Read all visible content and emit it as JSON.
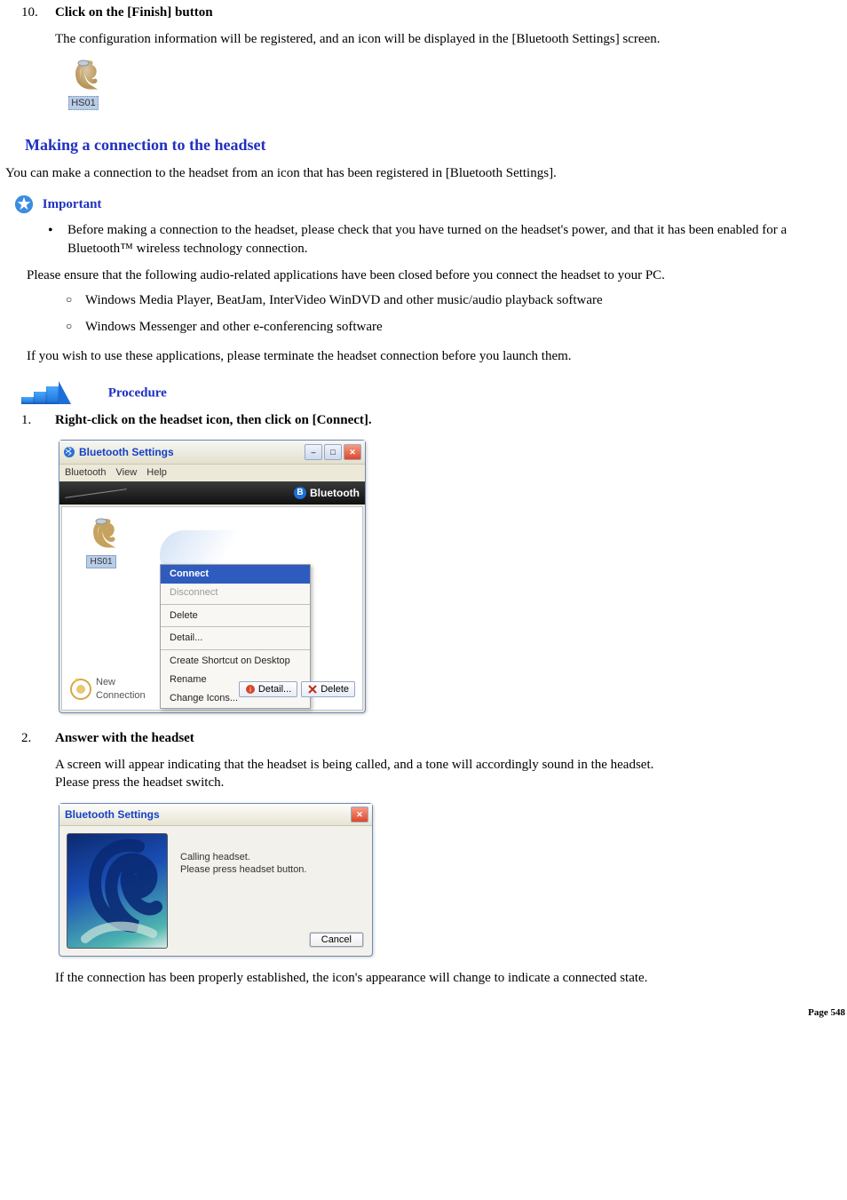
{
  "top_step": {
    "number": "10.",
    "title": "Click on the [Finish] button",
    "desc": "The configuration information will be registered, and an icon will be displayed in the [Bluetooth Settings] screen.",
    "icon_label": "HS01"
  },
  "section_title": "Making a connection to the headset",
  "section_intro": "You can make a connection to the headset from an icon that has been registered in [Bluetooth Settings].",
  "important_label": "Important",
  "important_bullet": "Before making a connection to the headset, please check that you have turned on the headset's power, and that it has been enabled for a Bluetooth™ wireless technology connection.",
  "ensure_text": "Please ensure that the following audio-related applications have been closed before you connect the headset to your PC.",
  "apps": [
    "Windows Media Player, BeatJam, InterVideo WinDVD and other music/audio playback software",
    "Windows Messenger and other e-conferencing software"
  ],
  "terminate_text": "If you wish to use these applications, please terminate the headset connection before you launch them.",
  "procedure_label": "Procedure",
  "step1": {
    "number": "1.",
    "title": "Right-click on the headset icon, then click on [Connect]."
  },
  "bt_window": {
    "title": "Bluetooth Settings",
    "menu": [
      "Bluetooth",
      "View",
      "Help"
    ],
    "band_text": "Bluetooth",
    "hs_label": "HS01",
    "context_menu": [
      "Connect",
      "Disconnect",
      "Delete",
      "Detail...",
      "Create Shortcut on Desktop",
      "Rename",
      "Change Icons..."
    ],
    "footer_new_line1": "New",
    "footer_new_line2": "Connection",
    "btn_detail": "Detail...",
    "btn_delete": "Delete",
    "min_glyph": "–",
    "max_glyph": "□",
    "close_glyph": "✕",
    "bt_glyph": "B"
  },
  "step2": {
    "number": "2.",
    "title": "Answer with the headset",
    "desc1": "A screen will appear indicating that the headset is being called, and a tone will accordingly sound in the headset.",
    "desc2": "Please press the headset switch."
  },
  "dialog": {
    "title": "Bluetooth Settings",
    "msg1": "Calling headset.",
    "msg2": "Please press headset button.",
    "cancel": "Cancel",
    "close_glyph": "✕"
  },
  "final_text": "If the connection has been properly established, the icon's appearance will change to indicate a connected state.",
  "page_footer": "Page 548"
}
